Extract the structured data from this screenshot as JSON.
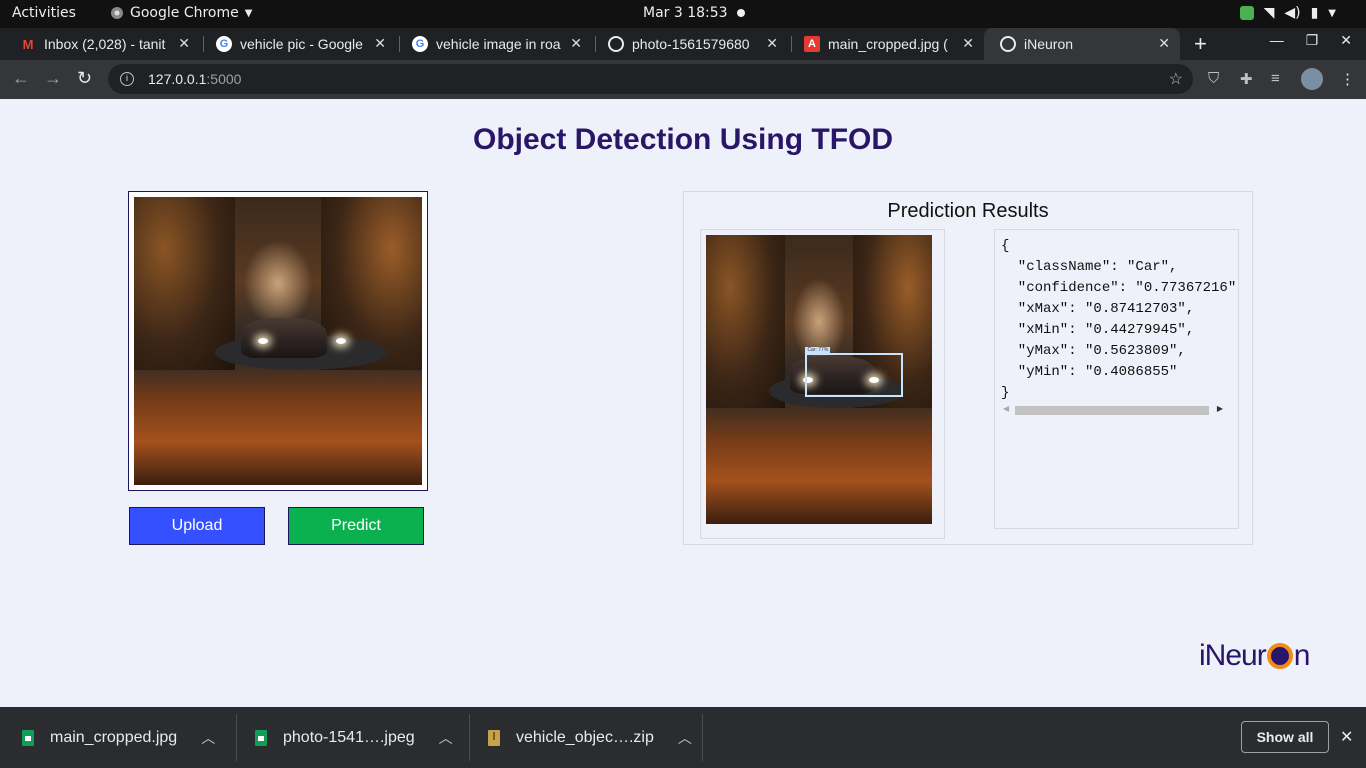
{
  "system_bar": {
    "activities": "Activities",
    "app_name": "Google Chrome",
    "clock": "Mar 3  18:53"
  },
  "tabs": [
    {
      "title": "Inbox (2,028) - tanit",
      "icon": "gmail-icon",
      "active": false
    },
    {
      "title": "vehicle pic - Google",
      "icon": "google-icon",
      "active": false
    },
    {
      "title": "vehicle image in roa",
      "icon": "google-icon",
      "active": false
    },
    {
      "title": "photo-1561579680",
      "icon": "globe-icon",
      "active": false
    },
    {
      "title": "main_cropped.jpg (",
      "icon": "pdf-icon",
      "active": false
    },
    {
      "title": "iNeuron",
      "icon": "globe-icon",
      "active": true
    }
  ],
  "address_bar": {
    "host": "127.0.0.1",
    "port": ":5000"
  },
  "page": {
    "title": "Object Detection Using TFOD",
    "upload_label": "Upload",
    "predict_label": "Predict",
    "results_title": "Prediction Results",
    "json_lines": [
      "{",
      "  \"className\": \"Car\",",
      "  \"confidence\": \"0.77367216\"",
      "  \"xMax\": \"0.87412703\",",
      "  \"xMin\": \"0.44279945\",",
      "  \"yMax\": \"0.5623809\",",
      "  \"yMin\": \"0.4086855\"",
      "}"
    ],
    "bbox_label": "Car: 77%",
    "logo_text_before": "iNeur",
    "logo_text_after": "n"
  },
  "colors": {
    "title": "#2a1668",
    "upload_button": "#3550ff",
    "predict_button": "#0bb14f"
  },
  "downloads": {
    "items": [
      {
        "name": "main_cropped.jpg",
        "icon": "image-file-icon"
      },
      {
        "name": "photo-1541….jpeg",
        "icon": "image-file-icon"
      },
      {
        "name": "vehicle_objec….zip",
        "icon": "zip-file-icon"
      }
    ],
    "show_all": "Show all"
  }
}
